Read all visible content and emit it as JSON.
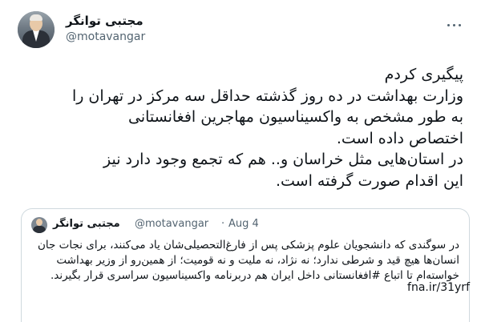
{
  "author": {
    "name": "مجتبی توانگر",
    "handle": "@motavangar"
  },
  "tweet": {
    "text": "پیگیری کردم\nوزارت بهداشت در ده روز گذشته حداقل سه مرکز در تهران را\nبه طور مشخص به واکسیناسیون مهاجرین افغانستانی\nاختصاص داده است.\nدر استان‌هایی مثل خراسان و.. هم که تجمع وجود دارد نیز\nاین اقدام صورت گرفته است."
  },
  "quoted_tweet": {
    "name": "مجتبی توانگر",
    "handle": "@motavangar",
    "separator": "·",
    "date": "Aug 4",
    "text": "در سوگندی که دانشجویان علوم پزشکی پس از فارغ‌التحصیلی‌شان یاد می‌کنند، برای نجات جان انسان‌ها هیچ قید و شرطی ندارد؛ نه نژاد، نه ملیت و نه قومیت؛ از همین‌رو از وزیر بهداشت خواسته‌ام تا اتباع #افغانستانی داخل ایران هم دربرنامه واکسیناسیون سراسری قرار بگیرند.",
    "link": "fna.ir/31yrf"
  },
  "icons": {
    "more": "more-options-icon"
  }
}
